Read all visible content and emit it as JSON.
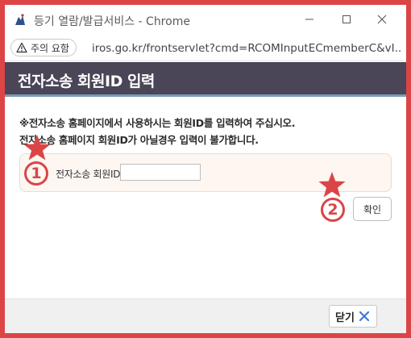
{
  "window": {
    "title": "등기 열람/발급서비스 - Chrome",
    "app_icon": "court-logo-icon",
    "controls": [
      "minimize-icon",
      "maximize-icon",
      "close-icon"
    ]
  },
  "address_bar": {
    "security_chip": "주의 요함",
    "security_icon": "warning-triangle-icon",
    "url": "iros.go.kr/frontservlet?cmd=RCOMInputECmemberC&vI..."
  },
  "page": {
    "title": "전자소송 회원ID 입력",
    "notice_line1": "※전자소송 홈페이지에서 사용하시는 회원ID를 입력하여 주십시오.",
    "notice_line2": "전자소송 홈페이지 회원ID가 아닐경우 입력이 불가합니다.",
    "field_label": "전자소송 회원ID",
    "field_value": "",
    "confirm_label": "확인"
  },
  "footer": {
    "close_label": "닫기",
    "close_icon": "x-icon"
  },
  "annotations": {
    "marker_1": "1",
    "marker_2": "2",
    "color": "#dc4446"
  },
  "colors": {
    "frame_border": "#dc4446",
    "header_bg": "#4a4557",
    "header_accent": "#7a9bb5",
    "input_box_bg": "#fdf6f1",
    "close_icon": "#3a7bd5"
  }
}
